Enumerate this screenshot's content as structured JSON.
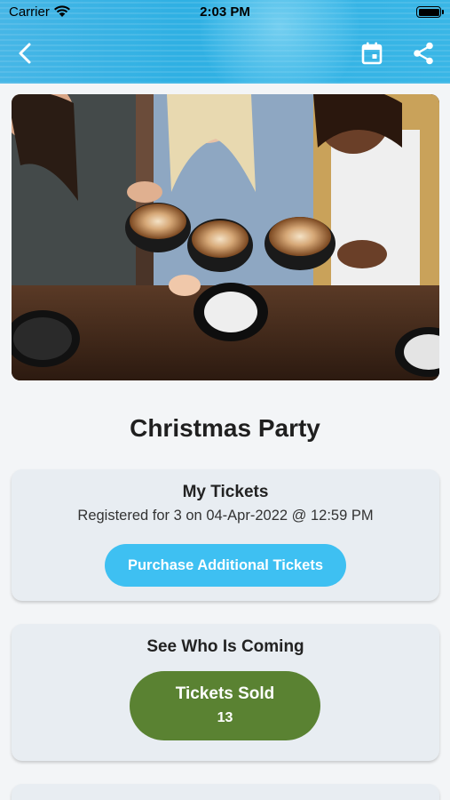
{
  "status_bar": {
    "carrier": "Carrier",
    "time": "2:03 PM"
  },
  "header": {
    "back_icon": "chevron-left-icon",
    "calendar_icon": "calendar-icon",
    "share_icon": "share-icon",
    "accent_color": "#2fb0e3"
  },
  "event": {
    "title": "Christmas Party",
    "image_icon": "event-photo"
  },
  "my_tickets": {
    "heading": "My Tickets",
    "registered_text": "Registered for 3 on 04-Apr-2022 @ 12:59 PM",
    "purchase_button_label": "Purchase Additional Tickets",
    "purchase_button_color": "#3ec0f2"
  },
  "who_is_coming": {
    "heading": "See Who Is Coming",
    "tickets_sold_label": "Tickets Sold",
    "tickets_sold_count": "13",
    "tickets_sold_color": "#5a8232"
  }
}
